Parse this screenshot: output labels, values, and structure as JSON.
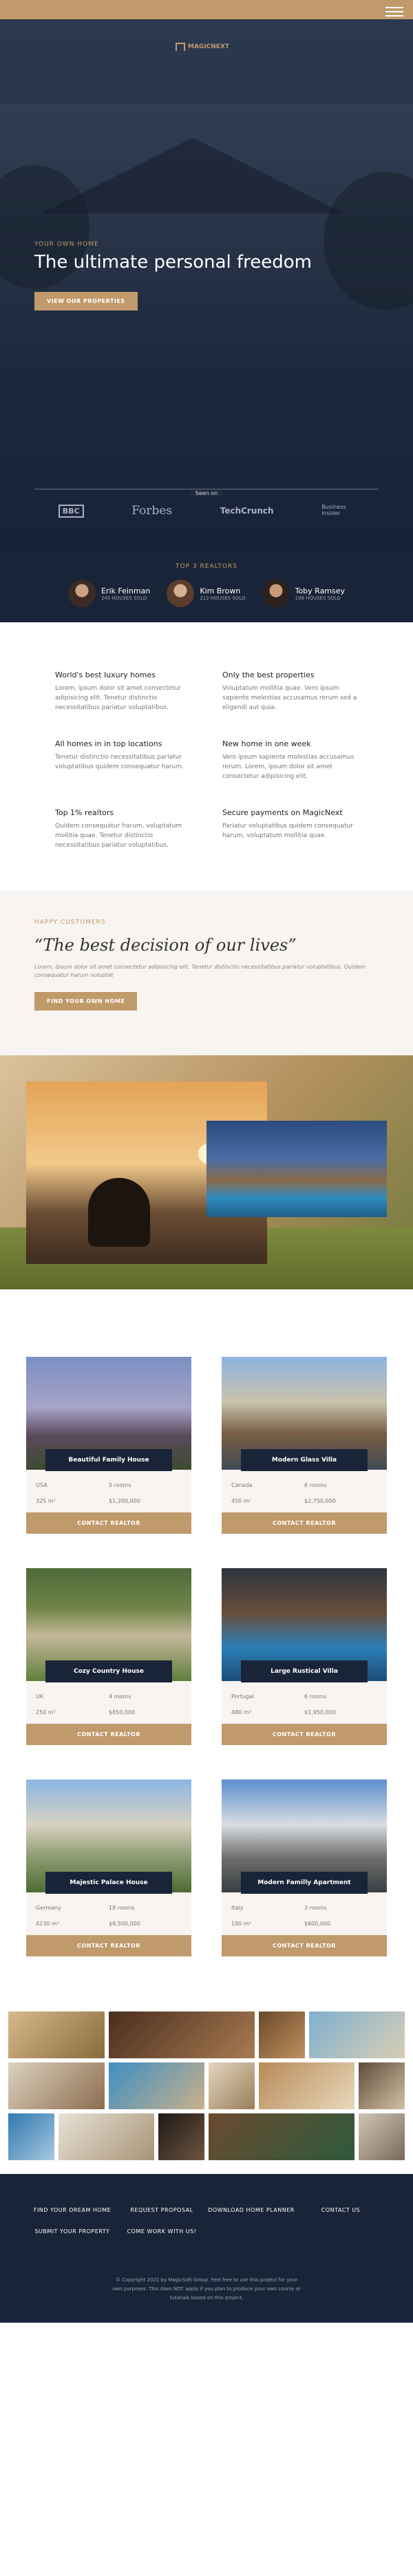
{
  "header": {
    "logo_text": "MAGICNEXT",
    "menu_icon": "hamburger-icon"
  },
  "hero": {
    "eyebrow": "YOUR OWN HOME",
    "title": "The ultimate personal freedom",
    "cta": "VIEW OUR PROPERTIES",
    "seen_on": "Seen on",
    "press": [
      "BBC",
      "Forbes",
      "TechCrunch",
      "Business Insider"
    ]
  },
  "realtors": {
    "heading": "TOP 3 REALTORS",
    "items": [
      {
        "name": "Erik Feinman",
        "sold": "245 HOUSES SOLD"
      },
      {
        "name": "Kim Brown",
        "sold": "212 HOUSES SOLD"
      },
      {
        "name": "Toby Ramsey",
        "sold": "198 HOUSES SOLD"
      }
    ]
  },
  "features": [
    {
      "title": "World's best luxury homes",
      "text": "Lorem, ipsum dolor sit amet consectetur adipisicing elit. Tenetur distinctio necessitatibus pariatur voluptatibus."
    },
    {
      "title": "Only the best properties",
      "text": "Voluptatum mollitia quae. Vero ipsum sapiente molestias accusamus rerum sed a eligendi aut quia."
    },
    {
      "title": "All homes in in top locations",
      "text": "Tenetur distinctio necessitatibus pariatur voluptatibus quidem consequatur harum."
    },
    {
      "title": "New home in one week",
      "text": "Vero ipsum sapiente molestias accusamus rerum. Lorem, ipsum dolor sit amet consectetur adipisicing elit."
    },
    {
      "title": "Top 1% realtors",
      "text": "Quidem consequatur harum, voluptatum mollitia quae. Tenetur distinctio necessitatibus pariatur voluptatibus."
    },
    {
      "title": "Secure payments on MagicNext",
      "text": "Pariatur voluptatibus quidem consequatur harum, voluptatum mollitia quae."
    }
  ],
  "testimonial": {
    "label": "HAPPY CUSTOMERS",
    "quote": "“The best decision of our lives”",
    "text": "Lorem, ipsum dolor sit amet consectetur adipisicing elit. Tenetur distinctio necessitatibus pariatur voluptatibus. Quidem consequatur harum voluptat",
    "cta": "FIND YOUR OWN HOME"
  },
  "homes": [
    {
      "title": "Beautiful Family House",
      "country": "USA",
      "rooms": "5 rooms",
      "area": "325 m²",
      "price": "$1,200,000",
      "cta": "CONTACT REALTOR"
    },
    {
      "title": "Modern Glass Villa",
      "country": "Canada",
      "rooms": "6 rooms",
      "area": "450 m²",
      "price": "$2,750,000",
      "cta": "CONTACT REALTOR"
    },
    {
      "title": "Cozy Country House",
      "country": "UK",
      "rooms": "4 rooms",
      "area": "250 m²",
      "price": "$850,000",
      "cta": "CONTACT REALTOR"
    },
    {
      "title": "Large Rustical Villa",
      "country": "Portugal",
      "rooms": "6 rooms",
      "area": "480 m²",
      "price": "$1,950,000",
      "cta": "CONTACT REALTOR"
    },
    {
      "title": "Majestic Palace House",
      "country": "Germany",
      "rooms": "18 rooms",
      "area": "4230 m²",
      "price": "$9,500,000",
      "cta": "CONTACT REALTOR"
    },
    {
      "title": "Modern Familly Apartment",
      "country": "Italy",
      "rooms": "3 rooms",
      "area": "180 m²",
      "price": "$600,000",
      "cta": "CONTACT REALTOR"
    }
  ],
  "footer": {
    "nav": [
      "FIND YOUR DREAM HOME",
      "REQUEST PROPOSAL",
      "DOWNLOAD HOME PLANNER",
      "CONTACT US",
      "SUBMIT YOUR PROPERTY",
      "COME WORK WITH US!"
    ],
    "copyright": "© Copyright 2021 by MagicSoft Group. Feel free to use this project for your own purposes. This does NOT apply if you plan to produce your own course or tutorials based on this project."
  },
  "colors": {
    "accent": "#c19a6b",
    "navy": "#1a2438"
  }
}
